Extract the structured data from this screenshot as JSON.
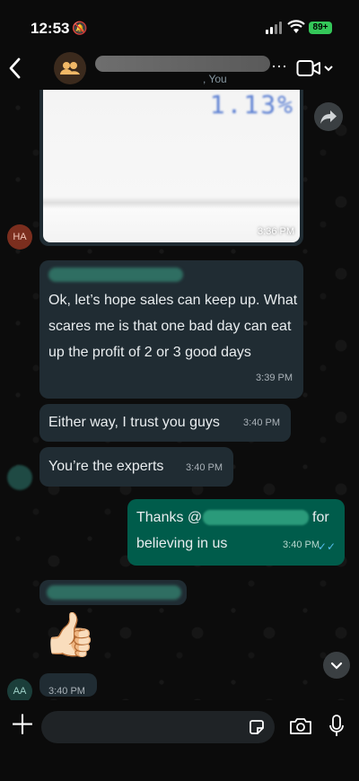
{
  "status_bar": {
    "time": "12:53",
    "battery": "89+"
  },
  "header": {
    "subtitle": ", You"
  },
  "messages": {
    "image_time": "3:36 PM",
    "image_text": "1.13%",
    "avatar_ha": "HA",
    "m1": {
      "text": "Ok, let’s hope sales can keep up. What scares me is that one bad day can eat up the profit of 2 or 3 good days",
      "time": "3:39 PM"
    },
    "m2": {
      "text": "Either way, I trust you guys",
      "time": "3:40 PM"
    },
    "m3": {
      "text": "You’re the experts",
      "time": "3:40 PM"
    },
    "m4": {
      "line1": "Thanks @",
      "for": "for",
      "line2": "believing in us",
      "time": "3:40 PM",
      "ticks": "✓✓"
    },
    "m5": {
      "emoji": "👍🏻",
      "time": "3:40 PM"
    },
    "avatar_aa": "AA"
  },
  "composer": {
    "value": ""
  },
  "colors": {
    "outgoing": "#005c4b",
    "incoming": "#202c33",
    "read_ticks": "#53bdeb"
  }
}
